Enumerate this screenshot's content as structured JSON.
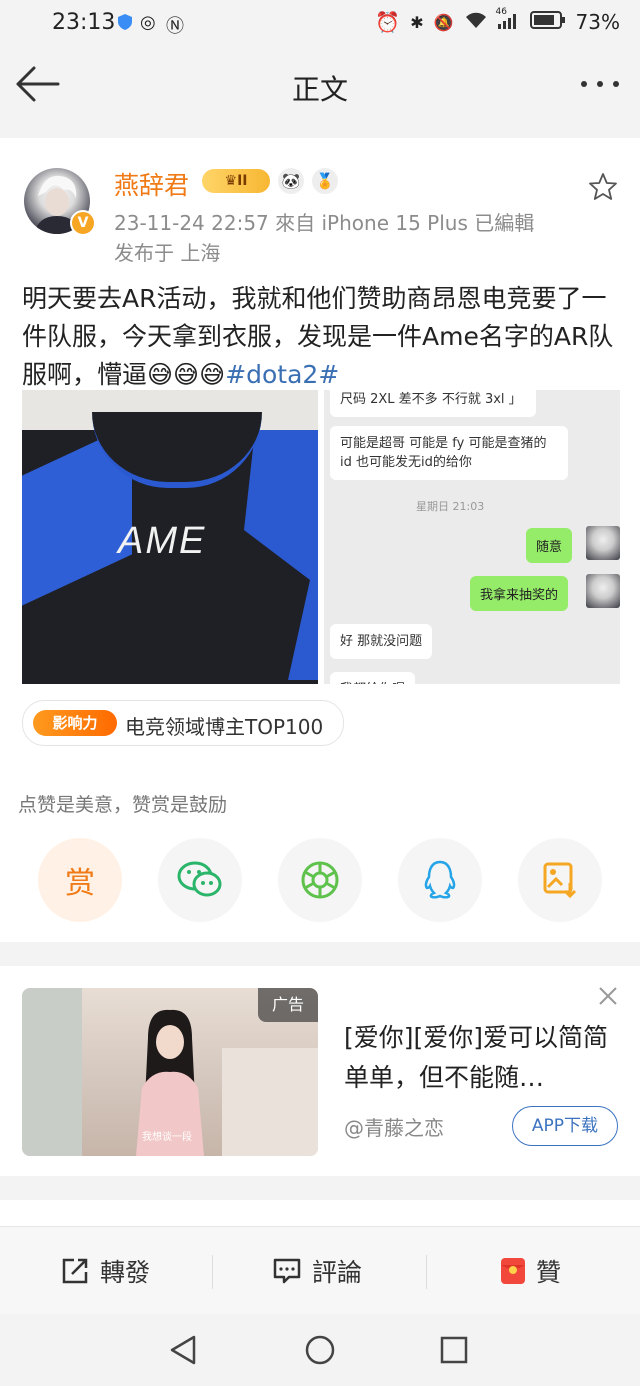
{
  "status_bar": {
    "time": "23:13",
    "battery": "73%",
    "network": "46"
  },
  "nav": {
    "title": "正文"
  },
  "post": {
    "username": "燕辞君",
    "level_badge": "II",
    "meta_line1": "23-11-24 22:57  來自 iPhone 15 Plus  已編輯",
    "meta_line2": "发布于 上海",
    "text": "明天要去AR活动，我就和他们赞助商昂恩电竞要了一件队服，今天拿到衣服，发现是一件Ame名字的AR队服啊，懵逼😅😅😅",
    "hashtag": "#dota2#",
    "shirt_text": "AME",
    "chat": {
      "top_cut": "尺码 2XL 差不多 不行就 3xl 」",
      "msg1": "可能是超哥 可能是 fy 可能是查猪的 id 也可能发无id的给你",
      "time": "星期日 21:03",
      "reply1": "随意",
      "reply2": "我拿来抽奖的",
      "msg2": "好 那就没问题",
      "bottom_cut": "我都给你喔"
    },
    "influence_logo": "影响力",
    "influence_text": "电竞领域博主TOP100",
    "reward_hint": "点赞是美意，赞赏是鼓励",
    "reward_label": "赏"
  },
  "ad": {
    "badge": "广告",
    "title": "[爱你][爱你]爱可以简简单单，但不能随…",
    "source": "@青藤之恋",
    "button": "APP下载",
    "caption": "我想谈一段"
  },
  "actions": {
    "repost": "轉發",
    "comment": "評論",
    "like": "贊"
  },
  "colors": {
    "accent_orange": "#f07b16",
    "link_blue": "#3b6fb3"
  }
}
